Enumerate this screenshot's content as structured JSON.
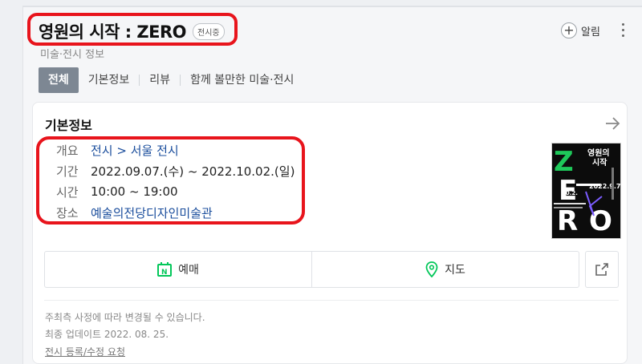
{
  "header": {
    "title": "영원의 시작 : ZERO",
    "badge": "전시중",
    "subtitle": "미술·전시 정보",
    "alarm_label": "알림",
    "alarm_icon": "plus-circle-icon",
    "more_icon": "kebab-icon"
  },
  "tabs": [
    {
      "label": "전체",
      "active": true
    },
    {
      "label": "기본정보",
      "active": false
    },
    {
      "label": "리뷰",
      "active": false
    },
    {
      "label": "함께 볼만한 미술·전시",
      "active": false
    }
  ],
  "card": {
    "title": "기본정보",
    "arrow_icon": "arrow-right-icon",
    "info": [
      {
        "key": "개요",
        "value": "전시 > 서울 전시"
      },
      {
        "key": "기간",
        "value": "2022.09.07.(수) ~ 2022.10.02.(일)"
      },
      {
        "key": "시간",
        "value": "10:00 ~ 19:00"
      },
      {
        "key": "장소",
        "value": "예술의전당디자인미술관"
      }
    ],
    "poster": {
      "title_line1": "영원의",
      "title_line2": "시작",
      "date_text": "2022.9.7.",
      "date_text2": "10.2."
    },
    "buttons": {
      "reserve_label": "예매",
      "map_label": "지도",
      "share_icon": "share-icon"
    },
    "notes": {
      "line1": "주최측 사정에 따라 변경될 수 있습니다.",
      "line2": "최종 업데이트 2022. 08. 25.",
      "line3": "전시 등록/수정 요청"
    }
  },
  "colors": {
    "highlight": "#e8141c",
    "link": "#1a4d9c",
    "tab_active": "#7d8793",
    "naver_green": "#03c75a"
  }
}
